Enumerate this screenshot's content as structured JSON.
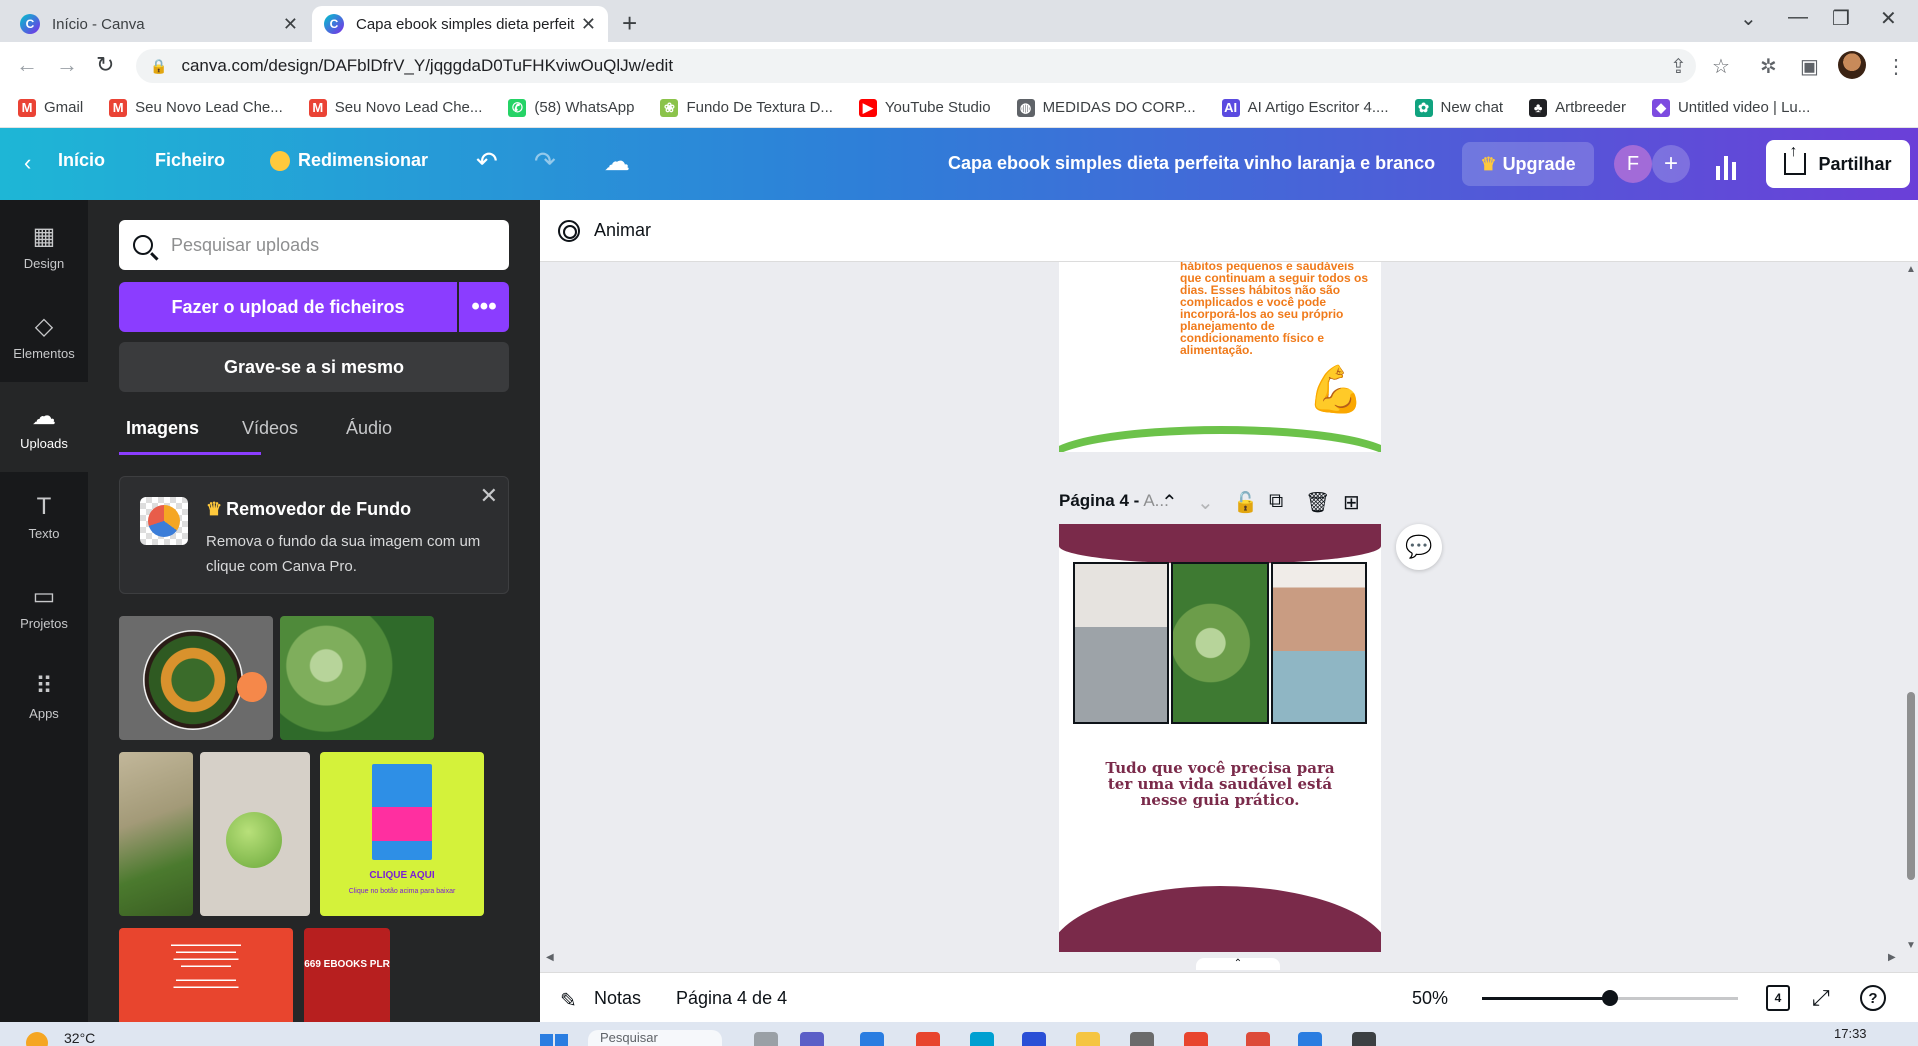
{
  "browser": {
    "tabs": [
      {
        "title": "Início - Canva",
        "active": false
      },
      {
        "title": "Capa ebook simples dieta perfeita",
        "active": true
      }
    ],
    "url": "canva.com/design/DAFblDfrV_Y/jqggdaD0TuFHKviwOuQlJw/edit",
    "bookmarks": [
      {
        "label": "Gmail",
        "icon": "gmail-icon",
        "color": "#ea4335"
      },
      {
        "label": "Seu Novo Lead Che...",
        "icon": "gmail-icon",
        "color": "#ea4335"
      },
      {
        "label": "Seu Novo Lead Che...",
        "icon": "gmail-icon",
        "color": "#ea4335"
      },
      {
        "label": "(58) WhatsApp",
        "icon": "whatsapp-icon",
        "color": "#25d366"
      },
      {
        "label": "Fundo De Textura D...",
        "icon": "leaf-icon",
        "color": "#8bc34a"
      },
      {
        "label": "YouTube Studio",
        "icon": "youtube-icon",
        "color": "#ff0000"
      },
      {
        "label": "MEDIDAS DO CORP...",
        "icon": "globe-icon",
        "color": "#5f6368"
      },
      {
        "label": "AI Artigo Escritor 4....",
        "icon": "ai-writer-icon",
        "color": "#5b4be0"
      },
      {
        "label": "New chat",
        "icon": "openai-icon",
        "color": "#10a37f"
      },
      {
        "label": "Artbreeder",
        "icon": "artbreeder-icon",
        "color": "#202124"
      },
      {
        "label": "Untitled video | Lu...",
        "icon": "lumen-icon",
        "color": "#7d4be0"
      }
    ]
  },
  "header": {
    "home": "Início",
    "file": "Ficheiro",
    "resize": "Redimensionar",
    "title": "Capa ebook simples dieta perfeita vinho laranja e branco",
    "upgrade": "Upgrade",
    "avatar_letter": "F",
    "share": "Partilhar"
  },
  "rail": [
    {
      "label": "Design",
      "icon": "design-icon"
    },
    {
      "label": "Elementos",
      "icon": "elements-icon"
    },
    {
      "label": "Uploads",
      "icon": "upload-cloud-icon",
      "active": true
    },
    {
      "label": "Texto",
      "icon": "text-icon"
    },
    {
      "label": "Projetos",
      "icon": "folder-icon"
    },
    {
      "label": "Apps",
      "icon": "apps-grid-icon"
    }
  ],
  "panel": {
    "search_placeholder": "Pesquisar uploads",
    "upload_button": "Fazer o upload de ficheiros",
    "more_button": "•••",
    "record_button": "Grave-se a si mesmo",
    "tabs": [
      "Imagens",
      "Vídeos",
      "Áudio"
    ],
    "active_tab": "Imagens",
    "promo": {
      "title": "Removedor de Fundo",
      "description": "Remova o fundo da sua imagem com um clique com Canva Pro."
    },
    "book_thumb": {
      "cta": "CLIQUE AQUI",
      "sub": "Clique no botão acima para baixar"
    },
    "ebooks_thumb": "669 EBOOKS PLR"
  },
  "editor": {
    "animate": "Animar",
    "page3_text": "hábitos pequenos e saudáveis que continuam a seguir todos os dias. Esses hábitos não são complicados e você pode incorporá-los ao seu próprio planejamento de condicionamento físico e alimentação.",
    "page_label": "Página 4 -",
    "page_label_suffix": "A...",
    "page4_quote": "Tudo que você precisa para ter uma vida saudável está nesse guia prático.",
    "colors": {
      "wine": "#7a2a4a",
      "orange": "#f07a1a",
      "green": "#6cc24a"
    }
  },
  "footer": {
    "notes": "Notas",
    "page_info": "Página 4 de 4",
    "zoom": "50%",
    "zoom_level": 0.5,
    "page_count": "4"
  },
  "taskbar": {
    "temperature": "32°C",
    "search": "Pesquisar",
    "time": "17:33"
  }
}
